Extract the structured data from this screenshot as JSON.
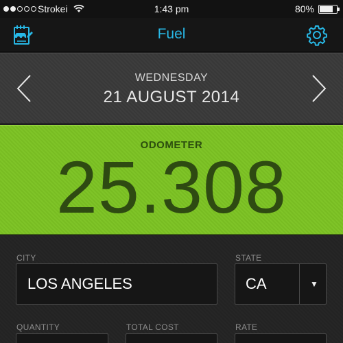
{
  "status_bar": {
    "carrier": "Strokei",
    "time": "1:43 pm",
    "battery": "80%",
    "battery_level": 0.8
  },
  "nav": {
    "title": "Fuel",
    "accent_color": "#28b8e6",
    "left_icon": "fuel-log-icon",
    "right_icon": "gear-icon"
  },
  "date": {
    "weekday": "WEDNESDAY",
    "full": "21 AUGUST 2014"
  },
  "odometer": {
    "label": "ODOMETER",
    "value": "25.308",
    "color": "#7fc428"
  },
  "form": {
    "city": {
      "label": "CITY",
      "value": "LOS ANGELES"
    },
    "state": {
      "label": "STATE",
      "value": "CA"
    },
    "quantity": {
      "label": "QUANTITY"
    },
    "total_cost": {
      "label": "TOTAL COST"
    },
    "rate": {
      "label": "RATE"
    }
  }
}
